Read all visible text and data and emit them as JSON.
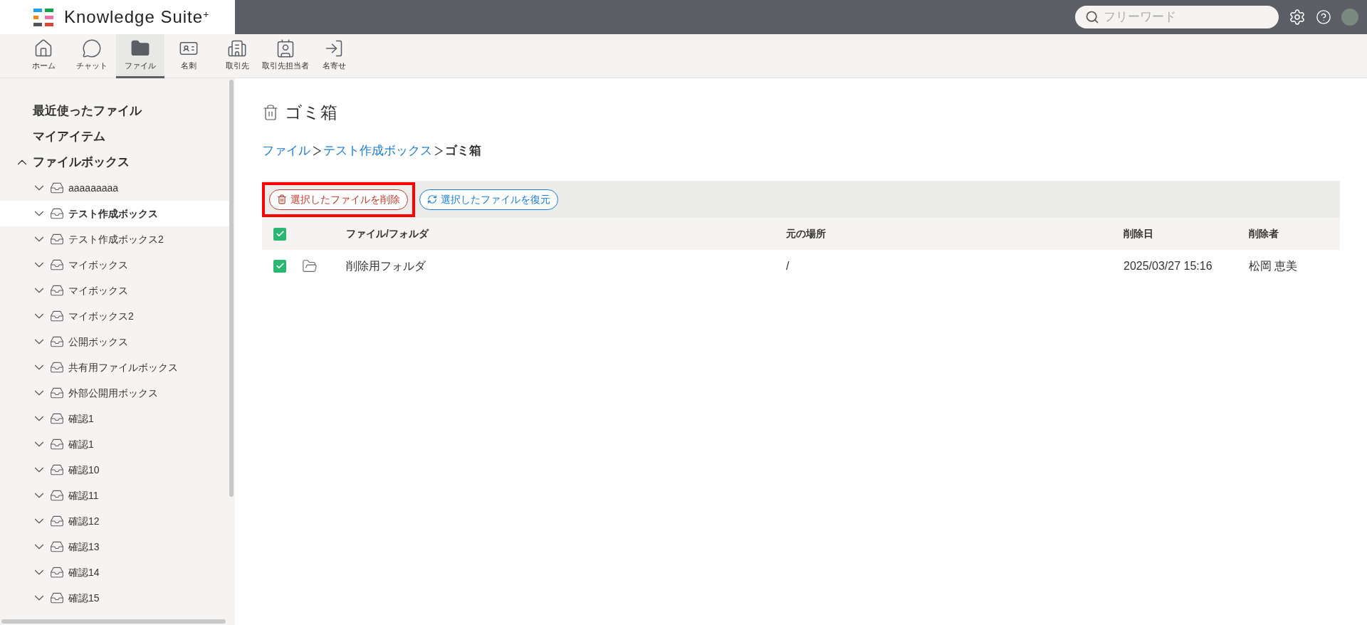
{
  "header": {
    "logo_text": "Knowledge Suite",
    "logo_sup": "+",
    "search": {
      "placeholder": "フリーワード"
    }
  },
  "nav": [
    {
      "label": "ホーム",
      "selected": false
    },
    {
      "label": "チャット",
      "selected": false
    },
    {
      "label": "ファイル",
      "selected": true
    },
    {
      "label": "名刺",
      "selected": false
    },
    {
      "label": "取引先",
      "selected": false
    },
    {
      "label": "取引先担当者",
      "selected": false
    },
    {
      "label": "名寄せ",
      "selected": false
    }
  ],
  "sidebar": {
    "items": [
      {
        "label": "最近使ったファイル"
      },
      {
        "label": "マイアイテム"
      },
      {
        "label": "ファイルボックス",
        "expanded": true,
        "children": [
          {
            "label": "aaaaaaaaa",
            "selected": false
          },
          {
            "label": "テスト作成ボックス",
            "selected": true
          },
          {
            "label": "テスト作成ボックス2",
            "selected": false
          },
          {
            "label": "マイボックス",
            "selected": false
          },
          {
            "label": "マイボックス",
            "selected": false
          },
          {
            "label": "マイボックス2",
            "selected": false
          },
          {
            "label": "公開ボックス",
            "selected": false
          },
          {
            "label": "共有用ファイルボックス",
            "selected": false
          },
          {
            "label": "外部公開用ボックス",
            "selected": false
          },
          {
            "label": "確認1",
            "selected": false
          },
          {
            "label": "確認1",
            "selected": false
          },
          {
            "label": "確認10",
            "selected": false
          },
          {
            "label": "確認11",
            "selected": false
          },
          {
            "label": "確認12",
            "selected": false
          },
          {
            "label": "確認13",
            "selected": false
          },
          {
            "label": "確認14",
            "selected": false
          },
          {
            "label": "確認15",
            "selected": false
          }
        ]
      }
    ]
  },
  "page": {
    "title": "ゴミ箱",
    "breadcrumb": [
      {
        "label": "ファイル",
        "link": true
      },
      {
        "label": "テスト作成ボックス",
        "link": true
      },
      {
        "label": "ゴミ箱",
        "link": false
      }
    ],
    "toolbar": [
      {
        "label": "選択したファイルを削除",
        "kind": "delete",
        "highlighted": true
      },
      {
        "label": "選択したファイルを復元",
        "kind": "restore",
        "highlighted": false
      }
    ],
    "table": {
      "select_all_checked": true,
      "columns": [
        "ファイル/フォルダ",
        "元の場所",
        "削除日",
        "削除者"
      ],
      "rows": [
        {
          "checked": true,
          "name": "削除用フォルダ",
          "location": "/",
          "deleted_at": "2025/03/27 15:16",
          "deleted_by": "松岡 恵美"
        }
      ]
    }
  }
}
